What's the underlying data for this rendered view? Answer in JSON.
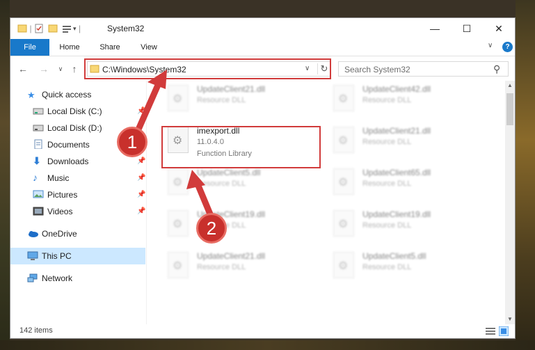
{
  "window": {
    "title": "System32",
    "controls": {
      "minimize": "—",
      "maximize": "☐",
      "close": "✕"
    }
  },
  "ribbon": {
    "tabs": [
      "File",
      "Home",
      "Share",
      "View"
    ],
    "help_icon": "?",
    "expand_icon": "∨"
  },
  "nav": {
    "back": "←",
    "forward": "→",
    "recent": "∨",
    "up": "↑",
    "address": "C:\\Windows\\System32",
    "address_dropdown": "∨",
    "refresh": "↻",
    "search_placeholder": "Search System32",
    "search_icon": "⚲"
  },
  "sidebar": {
    "items": [
      {
        "label": "Quick access",
        "icon": "star-icon",
        "pinned": false
      },
      {
        "label": "Local Disk (C:)",
        "icon": "drive-icon",
        "pinned": true
      },
      {
        "label": "Local Disk (D:)",
        "icon": "drive-icon",
        "pinned": false
      },
      {
        "label": "Documents",
        "icon": "document-icon",
        "pinned": false
      },
      {
        "label": "Downloads",
        "icon": "download-icon",
        "pinned": true
      },
      {
        "label": "Music",
        "icon": "music-icon",
        "pinned": true
      },
      {
        "label": "Pictures",
        "icon": "pictures-icon",
        "pinned": true
      },
      {
        "label": "Videos",
        "icon": "video-icon",
        "pinned": true
      },
      {
        "label": "OneDrive",
        "icon": "cloud-icon",
        "pinned": false
      },
      {
        "label": "This PC",
        "icon": "computer-icon",
        "pinned": false,
        "selected": true
      },
      {
        "label": "Network",
        "icon": "network-icon",
        "pinned": false
      }
    ],
    "pin_glyph": "📌"
  },
  "files": {
    "left": [
      {
        "name": "UpdateClient21.dll",
        "desc": "Resource DLL"
      },
      {
        "name": "imexport.dll",
        "version": "11.0.4.0",
        "desc": "Function Library"
      },
      {
        "name": "UpdateClient5.dll",
        "desc": "Resource DLL"
      },
      {
        "name": "UpdateClient19.dll",
        "desc": "Resource DLL"
      },
      {
        "name": "UpdateClient21.dll",
        "desc": "Resource DLL"
      }
    ],
    "right": [
      {
        "name": "UpdateClient42.dll",
        "desc": "Resource DLL"
      },
      {
        "name": "UpdateClient21.dll",
        "desc": "Resource DLL"
      },
      {
        "name": "UpdateClient65.dll",
        "desc": "Resource DLL"
      },
      {
        "name": "UpdateClient19.dll",
        "desc": "Resource DLL"
      },
      {
        "name": "UpdateClient5.dll",
        "desc": "Resource DLL"
      }
    ]
  },
  "status": {
    "item_count": "142 items"
  },
  "callouts": {
    "one": "1",
    "two": "2"
  },
  "colors": {
    "accent": "#1979ca",
    "highlight": "#d13b3b",
    "badge": "#c8302c",
    "selected": "#cce8ff"
  }
}
